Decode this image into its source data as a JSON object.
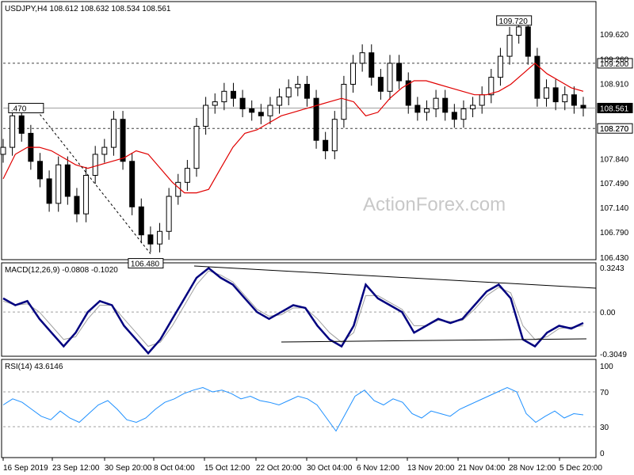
{
  "chart_data": [
    {
      "type": "candlestick",
      "pane": "price",
      "title": "USDJPY,H4  108.612 108.632 108.534 108.561",
      "watermark": "ActionForex.com",
      "ylim": [
        106.43,
        109.9
      ],
      "y_ticks": [
        "109.620",
        "109.260",
        "108.910",
        "108.561",
        "108.270",
        "107.840",
        "107.490",
        "107.140",
        "106.790",
        "106.430"
      ],
      "x_ticks": [
        "16 Sep 2019",
        "23 Sep 12:00",
        "30 Sep 20:00",
        "8 Oct 04:00",
        "15 Oct 12:00",
        "22 Oct 20:00",
        "30 Oct 04:00",
        "6 Nov 12:00",
        "13 Nov 20:00",
        "21 Nov 04:00",
        "28 Nov 12:00",
        "5 Dec 20:00"
      ],
      "current_price": "108.561",
      "horizontal_levels": [
        {
          "value": 109.2,
          "label": "109.200",
          "style": "dashed"
        },
        {
          "value": 108.27,
          "label": "108.270",
          "style": "dashed"
        },
        {
          "value": 108.561,
          "label": "108.561",
          "style": "solid"
        }
      ],
      "annotations": [
        {
          "label": "109.720",
          "value": 109.72
        },
        {
          "label": "106.480",
          "value": 106.48
        },
        {
          "label": ".470",
          "value": 108.47
        }
      ],
      "trendline": {
        "from": 108.47,
        "to": 106.48,
        "style": "dashed"
      },
      "series": [
        {
          "values": [
            108.0,
            108.45,
            108.2,
            107.8,
            107.55,
            107.2,
            107.75,
            107.3,
            107.05,
            107.6,
            107.9,
            108.0,
            108.4,
            107.8,
            107.15,
            106.75,
            106.62,
            106.8,
            107.3,
            107.5,
            107.7,
            108.3,
            108.6,
            108.65,
            108.8,
            108.7,
            108.55,
            108.5,
            108.45,
            108.6,
            108.72,
            108.85,
            108.9,
            108.7,
            108.1,
            107.95,
            108.4,
            108.9,
            109.2,
            109.35,
            109.0,
            108.8,
            109.2,
            108.95,
            108.6,
            108.5,
            108.55,
            108.7,
            108.5,
            108.4,
            108.55,
            108.6,
            108.75,
            109.0,
            109.3,
            109.6,
            109.72,
            109.3,
            108.7,
            108.85,
            108.65,
            108.75,
            108.6,
            108.56
          ]
        },
        {
          "name": "MA",
          "values": [
            107.55,
            107.9,
            108.0,
            108.0,
            107.95,
            107.85,
            107.75,
            107.7,
            107.75,
            107.8,
            107.85,
            107.95,
            107.9,
            107.7,
            107.5,
            107.35,
            107.35,
            107.4,
            107.7,
            108.0,
            108.2,
            108.25,
            108.35,
            108.45,
            108.5,
            108.55,
            108.6,
            108.65,
            108.7,
            108.65,
            108.45,
            108.5,
            108.7,
            108.85,
            108.95,
            108.95,
            108.9,
            108.85,
            108.8,
            108.75,
            108.75,
            108.8,
            108.9,
            109.05,
            109.2,
            109.05,
            108.95,
            108.85,
            108.8
          ]
        }
      ]
    },
    {
      "type": "line",
      "pane": "macd",
      "title": "MACD(12,26,9) -0.0808 -0.1020",
      "ylim": [
        -0.3049,
        0.3243
      ],
      "y_ticks": [
        "0.3243",
        "0.00",
        "-0.3049"
      ],
      "series": [
        {
          "values": [
            0.1,
            0.05,
            0.08,
            -0.05,
            -0.15,
            -0.25,
            -0.15,
            0.0,
            0.08,
            0.05,
            -0.1,
            -0.2,
            -0.3,
            -0.2,
            -0.05,
            0.1,
            0.25,
            0.32,
            0.25,
            0.2,
            0.1,
            0.0,
            -0.05,
            0.0,
            0.05,
            0.03,
            -0.1,
            -0.2,
            -0.25,
            -0.1,
            0.2,
            0.1,
            0.05,
            0.0,
            -0.15,
            -0.1,
            -0.05,
            -0.08,
            -0.05,
            0.05,
            0.15,
            0.2,
            0.1,
            -0.2,
            -0.25,
            -0.15,
            -0.1,
            -0.12,
            -0.08
          ]
        },
        {
          "values": [
            0.08,
            0.05,
            0.06,
            0.0,
            -0.1,
            -0.2,
            -0.18,
            -0.05,
            0.05,
            0.05,
            -0.05,
            -0.15,
            -0.25,
            -0.22,
            -0.1,
            0.05,
            0.2,
            0.3,
            0.27,
            0.22,
            0.12,
            0.02,
            -0.03,
            -0.02,
            0.03,
            0.03,
            -0.05,
            -0.15,
            -0.22,
            -0.15,
            0.12,
            0.12,
            0.07,
            0.02,
            -0.1,
            -0.1,
            -0.06,
            -0.07,
            -0.06,
            0.02,
            0.12,
            0.18,
            0.14,
            -0.1,
            -0.2,
            -0.18,
            -0.12,
            -0.11,
            -0.1
          ]
        }
      ]
    },
    {
      "type": "line",
      "pane": "rsi",
      "title": "RSI(14) 43.6146",
      "ylim": [
        0,
        100
      ],
      "y_ticks": [
        "100",
        "70",
        "30",
        "0"
      ],
      "series": [
        {
          "values": [
            55,
            62,
            58,
            50,
            42,
            38,
            48,
            40,
            35,
            45,
            55,
            60,
            50,
            38,
            35,
            40,
            50,
            58,
            62,
            68,
            72,
            75,
            70,
            72,
            68,
            62,
            65,
            60,
            58,
            55,
            60,
            65,
            62,
            55,
            40,
            25,
            45,
            65,
            72,
            60,
            55,
            62,
            58,
            45,
            40,
            48,
            45,
            42,
            50,
            55,
            60,
            65,
            70,
            75,
            70,
            45,
            35,
            42,
            48,
            40,
            45,
            43.6
          ]
        }
      ]
    }
  ]
}
